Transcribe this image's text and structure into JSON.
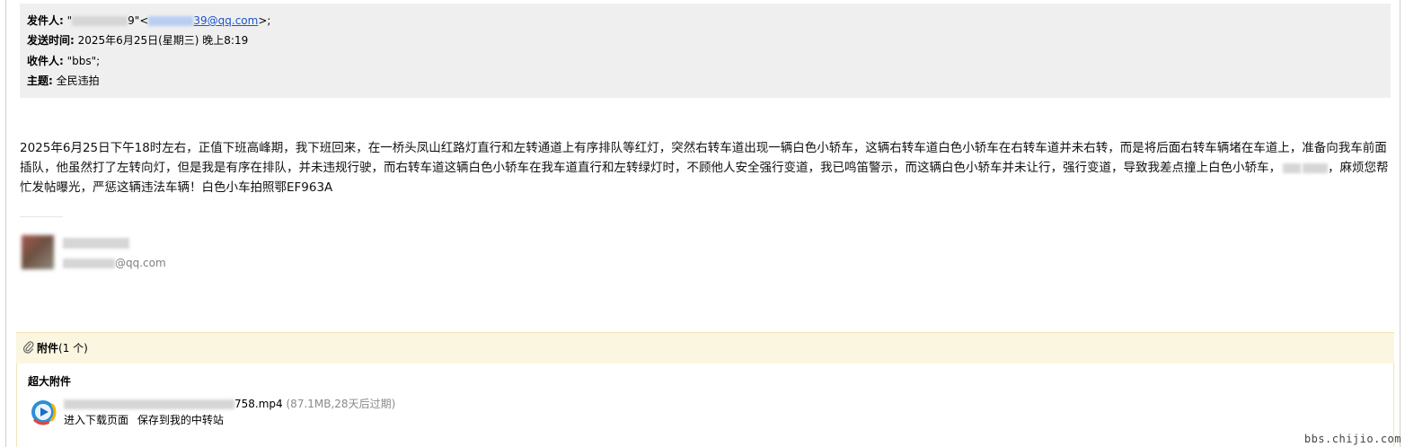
{
  "header": {
    "from_label": "发件人:",
    "from_prefix": "\"",
    "from_name_suffix": "9\"<",
    "from_email_suffix": "39@qq.com",
    "from_end": ">;",
    "time_label": "发送时间:",
    "time_value": "2025年6月25日(星期三) 晚上8:19",
    "to_label": "收件人:",
    "to_value": "\"bbs\";",
    "subject_label": "主题:",
    "subject_value": "全民违拍"
  },
  "body": {
    "text_1": "2025年6月25日下午18时左右，正值下班高峰期，我下班回来，在一桥头凤山红路灯直行和左转通道上有序排队等红灯，突然右转车道出现一辆白色小轿车，这辆右转车道白色小轿车在右转车道并未右转，而是将后面右转车辆堵在车道上，准备向我车前面插队，他虽然打了左转向灯，但是我是有序在排队，并未违规行驶，而右转车道这辆白色小轿车在我车道直行和左转绿灯时，不顾他人安全强行变道，我已鸣笛警示，而这辆白色小轿车并未让行，强行变道，导致我差点撞上白色小轿车，",
    "text_2": "，麻烦您帮忙发帖曝光，严惩这辆违法车辆！白色小车拍照鄂EF963A"
  },
  "signature": {
    "email_suffix": "@qq.com"
  },
  "attachments": {
    "title": "附件",
    "count": "(1 个)",
    "big_label": "超大附件",
    "file_suffix": "758.mp4",
    "file_info": "(87.1MB,28天后过期)",
    "action_download": "进入下载页面",
    "action_save": "保存到我的中转站"
  },
  "watermark": "bbs.chijio.com",
  "icons": {
    "attachment": "paperclip-icon",
    "video_file": "media-player-icon"
  },
  "colors": {
    "link": "#1a55cc",
    "header_bg": "#efefef",
    "attach_bg": "#fbf6e0"
  }
}
